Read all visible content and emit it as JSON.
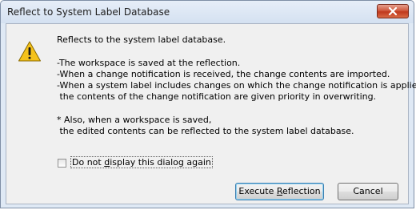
{
  "dialog": {
    "title": "Reflect to System Label Database",
    "close_label": "✕"
  },
  "message": {
    "icon": "warning-icon",
    "heading": "Reflects to the system label database.",
    "lines": [
      "-The workspace is saved at the reflection.",
      "-When a change notification is received, the change contents are imported.",
      "-When a system label includes changes on which the change notification is applied,",
      " the contents of the change notification are given priority in overwriting."
    ],
    "note_lines": [
      "* Also, when a workspace is saved,",
      " the edited contents can be reflected to the system label database."
    ]
  },
  "checkbox": {
    "label_before": "Do not ",
    "label_accel": "d",
    "label_after": "isplay this dialog again",
    "checked": false
  },
  "buttons": {
    "execute_before": "Execute ",
    "execute_accel": "R",
    "execute_after": "eflection",
    "cancel": "Cancel"
  },
  "colors": {
    "warning_fill": "#f5c21b",
    "close_button": "#c7432a",
    "default_button_border": "#3c7fb1"
  }
}
